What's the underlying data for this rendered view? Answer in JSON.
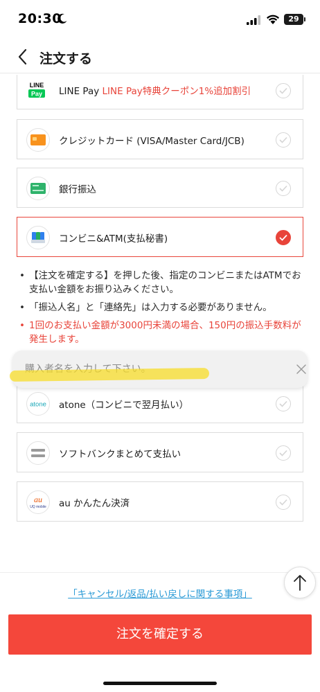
{
  "status_bar": {
    "time": "20:30",
    "battery": "29"
  },
  "nav": {
    "title": "注文する"
  },
  "payments": [
    {
      "id": "line-pay",
      "label": "LINE Pay",
      "promo": "LINE Pay特典クーポン1%追加割引",
      "icon": "line-pay-icon",
      "icon_text_top": "LINE",
      "icon_text_bottom": "Pay",
      "selected": false
    },
    {
      "id": "credit-card",
      "label": "クレジットカード (VISA/Master Card/JCB)",
      "icon": "credit-card-icon",
      "selected": false
    },
    {
      "id": "bank-transfer",
      "label": "銀行振込",
      "icon": "bank-icon",
      "selected": false
    },
    {
      "id": "convenience",
      "label": "コンビニ&ATM(支払秘書)",
      "icon": "store-icon",
      "selected": true
    },
    {
      "id": "atone",
      "label": "atone（コンビニで翌月払い）",
      "icon": "atone-icon",
      "icon_text": "atone",
      "selected": false
    },
    {
      "id": "softbank",
      "label": "ソフトバンクまとめて支払い",
      "icon": "softbank-icon",
      "selected": false
    },
    {
      "id": "au",
      "label": "au かんたん決済",
      "icon": "au-icon",
      "icon_text_top": "au",
      "icon_text_bottom": "UQ mobile",
      "selected": false
    }
  ],
  "notes": [
    {
      "text": "【注文を確定する】を押した後、指定のコンビニまたはATMでお支払い金額をお振り込みください。",
      "warn": false
    },
    {
      "text": "「振込人名」と「連絡先」は入力する必要がありません。",
      "warn": false
    },
    {
      "text": "1回のお支払い金額が3000円未満の場合、150円の振込手数料が発生します。",
      "warn": true
    }
  ],
  "buyer_input": {
    "placeholder": "購入者名を入力して下さい。",
    "value": ""
  },
  "footer": {
    "cancel_link": "「キャンセル/返品/払い戻しに関する事項」",
    "confirm_button": "注文を確定する"
  },
  "colors": {
    "accent": "#f4473b",
    "link": "#2a9ad6",
    "highlight": "#f7dc28"
  }
}
